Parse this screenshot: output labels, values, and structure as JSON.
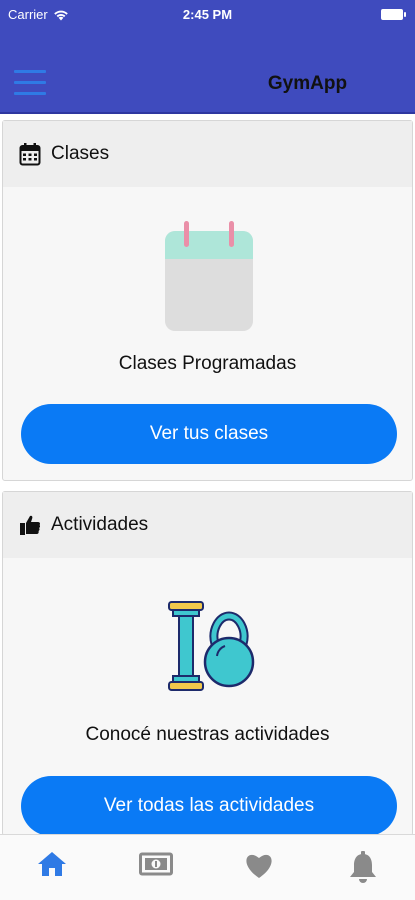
{
  "status_bar": {
    "carrier": "Carrier",
    "time": "2:45 PM"
  },
  "navbar": {
    "title": "GymApp",
    "menu_icon": "hamburger-menu-icon"
  },
  "cards": [
    {
      "header_icon": "calendar-icon",
      "header": "Clases",
      "illustration": "calendar-illustration",
      "caption": "Clases Programadas",
      "button": "Ver tus clases"
    },
    {
      "header_icon": "thumbs-up-icon",
      "header": "Actividades",
      "illustration": "dumbbell-kettlebell-illustration",
      "caption": "Conocé nuestras actividades",
      "button": "Ver todas las actividades"
    }
  ],
  "tabbar": {
    "tabs": [
      {
        "icon": "home-icon",
        "active": true
      },
      {
        "icon": "money-icon",
        "active": false
      },
      {
        "icon": "heart-icon",
        "active": false
      },
      {
        "icon": "bell-icon",
        "active": false
      }
    ]
  },
  "colors": {
    "header_bg": "#3f4bbe",
    "accent": "#0a7af5",
    "tab_active": "#2f7ae5",
    "tab_inactive": "#8a8a8a"
  }
}
